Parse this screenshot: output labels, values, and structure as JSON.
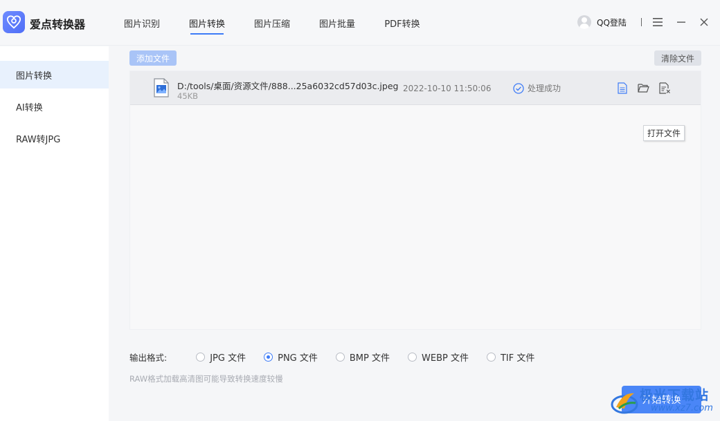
{
  "app": {
    "name": "爱点转换器"
  },
  "nav": {
    "tabs": [
      {
        "label": "图片识别"
      },
      {
        "label": "图片转换"
      },
      {
        "label": "图片压缩"
      },
      {
        "label": "图片批量"
      },
      {
        "label": "PDF转换"
      }
    ],
    "active": 1
  },
  "user": {
    "login_label": "QQ登陆"
  },
  "sidebar": {
    "items": [
      {
        "label": "图片转换"
      },
      {
        "label": "AI转换"
      },
      {
        "label": "RAW转JPG"
      }
    ],
    "active": 0
  },
  "toolbar": {
    "add_label": "添加文件",
    "clear_label": "清除文件"
  },
  "files": [
    {
      "path": "D:/tools/桌面/资源文件/888...25a6032cd57d03c.jpeg",
      "size": "45KB",
      "time": "2022-10-10 11:50:06",
      "status": "处理成功"
    }
  ],
  "tooltip": "打开文件",
  "output": {
    "label": "输出格式:",
    "options": [
      {
        "label": "JPG 文件"
      },
      {
        "label": "PNG 文件"
      },
      {
        "label": "BMP 文件"
      },
      {
        "label": "WEBP 文件"
      },
      {
        "label": "TIF 文件"
      }
    ],
    "selected": 1
  },
  "hint": "RAW格式加载高清图可能导致转换速度较慢",
  "start_label": "开始转换",
  "watermark": {
    "text": "极光下载站",
    "url": "www.xz7.com"
  },
  "colors": {
    "accent": "#3d7bf7",
    "start_button": "#4a86f7",
    "sidebar_active": "#e8f1fd"
  }
}
